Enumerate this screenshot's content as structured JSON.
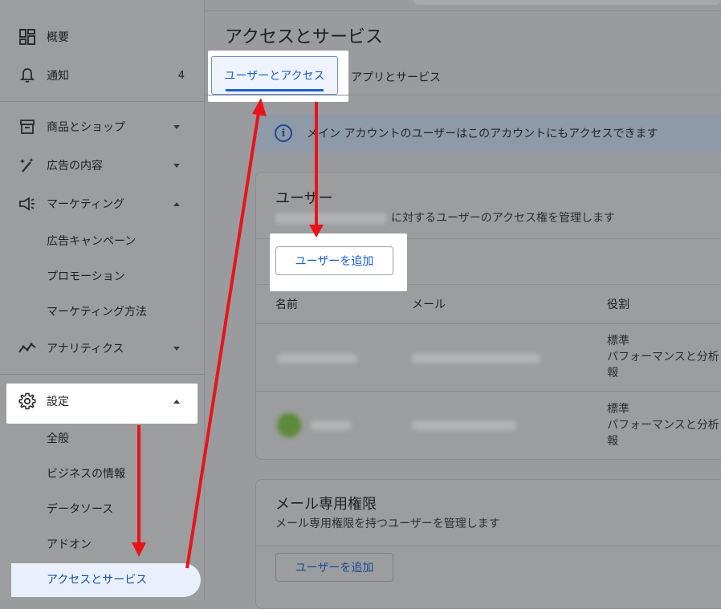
{
  "sidebar": {
    "items": [
      {
        "label": "概要",
        "icon": "dashboard-icon"
      },
      {
        "label": "通知",
        "icon": "bell-icon",
        "badge": "4"
      },
      {
        "label": "商品とショップ",
        "icon": "store-icon"
      },
      {
        "label": "広告の内容",
        "icon": "magic-wand-icon"
      },
      {
        "label": "マーケティング",
        "icon": "megaphone-icon"
      },
      {
        "label": "アナリティクス",
        "icon": "trend-line-icon"
      },
      {
        "label": "設定",
        "icon": "gear-icon"
      }
    ],
    "marketing_sub": [
      "広告キャンペーン",
      "プロモーション",
      "マーケティング方法"
    ],
    "settings_sub": [
      "全般",
      "ビジネスの情報",
      "データソース",
      "アドオン",
      "アクセスとサービス"
    ]
  },
  "main": {
    "title": "アクセスとサービス",
    "tabs": [
      {
        "label": "ユーザーとアクセス",
        "active": true
      },
      {
        "label": "アプリとサービス",
        "active": false
      }
    ],
    "info_banner": "メイン アカウントのユーザーはこのアカウントにもアクセスできます",
    "users_card": {
      "title": "ユーザー",
      "description": "に対するユーザーのアクセス権を管理します",
      "add_button": "ユーザーを追加",
      "columns": [
        "名前",
        "メール",
        "役割"
      ],
      "rows": [
        {
          "role_lines": [
            "標準",
            "パフォーマンスと分析",
            "報"
          ]
        },
        {
          "role_lines": [
            "標準",
            "パフォーマンスと分析",
            "報"
          ]
        }
      ]
    },
    "email_card": {
      "title": "メール専用権限",
      "description": "メール専用権限を持つユーザーを管理します",
      "add_button": "ユーザーを追加"
    }
  },
  "colors": {
    "accent": "#1a5fd0",
    "annotation_arrow": "#e8141a"
  }
}
